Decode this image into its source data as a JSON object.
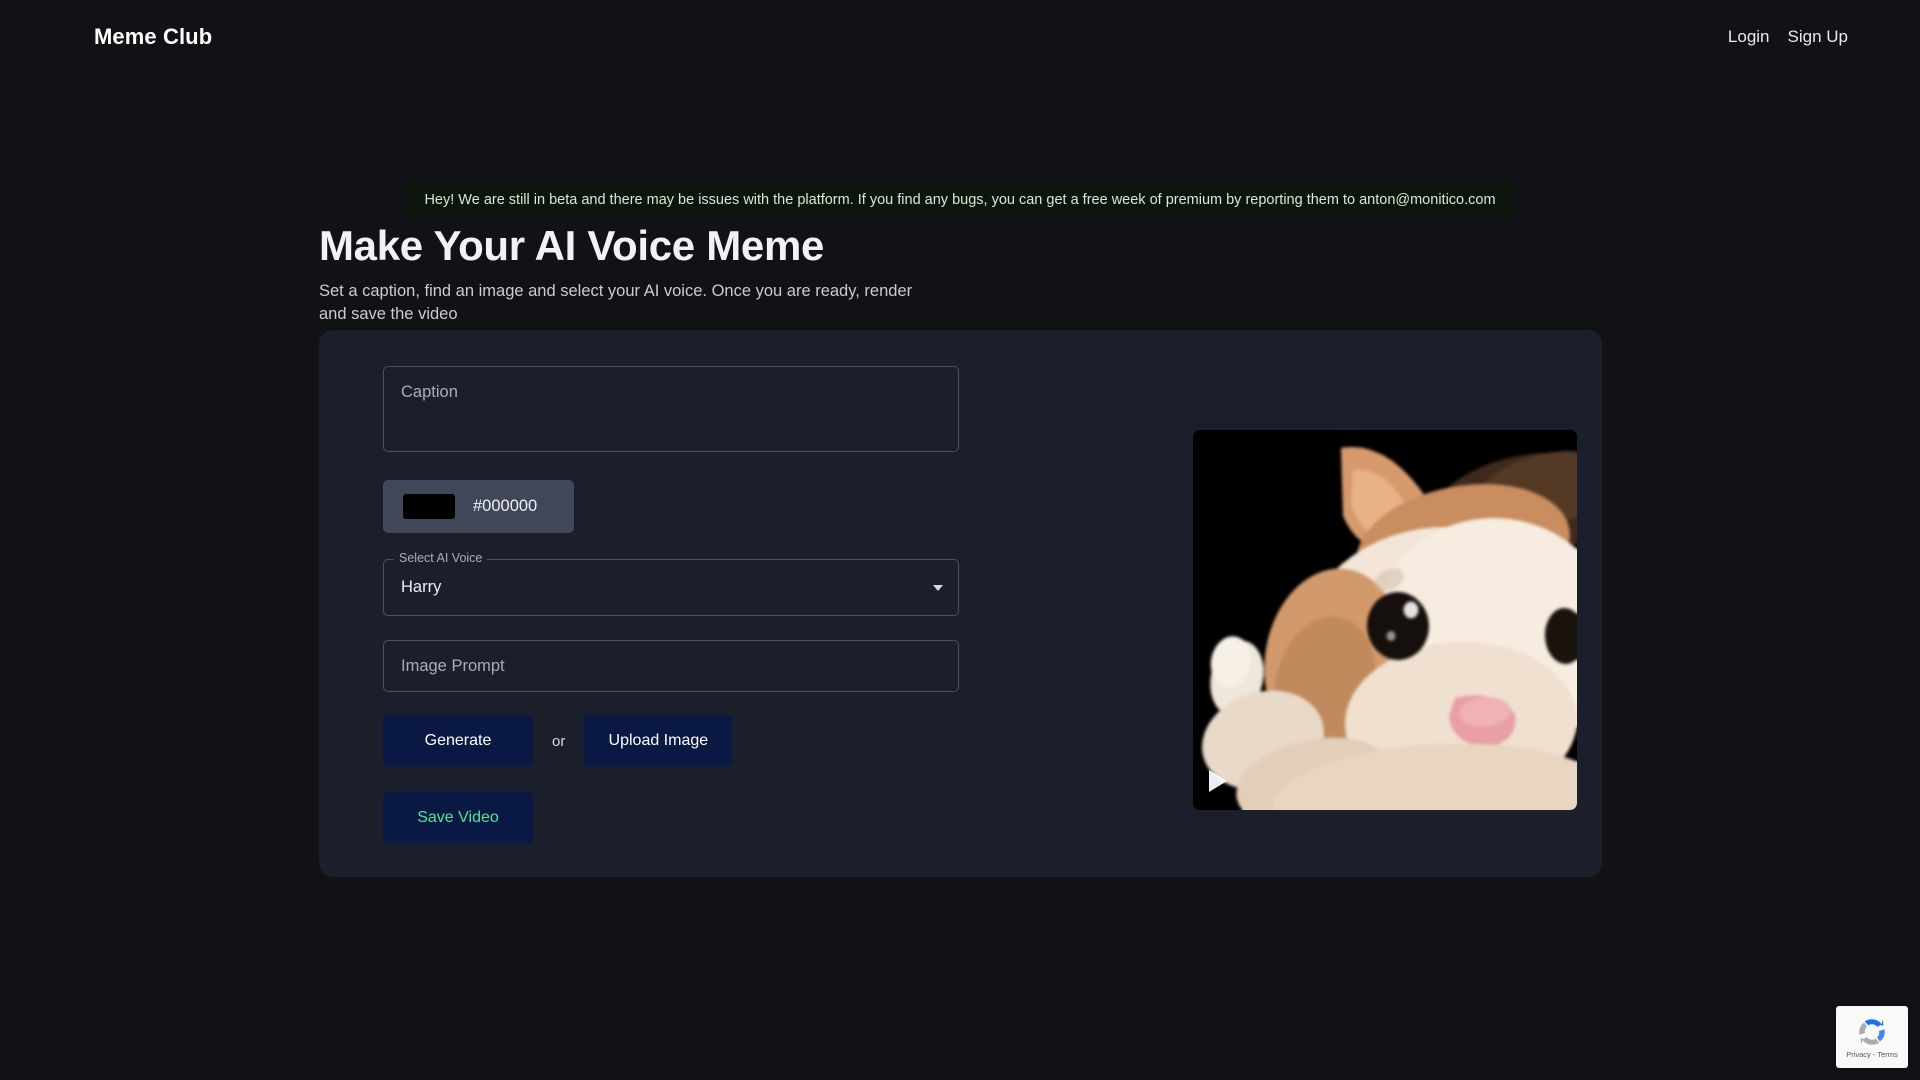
{
  "navbar": {
    "brand": "Meme Club",
    "links": [
      {
        "label": "Login"
      },
      {
        "label": "Sign Up"
      }
    ]
  },
  "banner": {
    "text": "Hey! We are still in beta and there may be issues with the platform. If you find any bugs, you can get a free week of premium by reporting them to anton@monitico.com",
    "background_color": "#0c150c",
    "text_color": "#d5ead4"
  },
  "hero": {
    "title": "Make Your AI Voice Meme",
    "subtitle": "Set a caption, find an image and select your AI voice. Once you are ready, render and save the video"
  },
  "form": {
    "caption": {
      "label": "Caption",
      "placeholder": "Caption",
      "value": ""
    },
    "color_picker": {
      "value": "#000000",
      "swatch_color": "#000000",
      "background_color": "#3f4758"
    },
    "voice_select": {
      "legend": "Select AI Voice",
      "value": "Harry",
      "caret_icon": "chevron-down-icon"
    },
    "image_prompt": {
      "placeholder": "Image Prompt",
      "value": ""
    },
    "generate_button": "Generate",
    "or_text": "or",
    "upload_button": "Upload Image",
    "save_button": "Save Video",
    "button_color": "#0a1944",
    "save_button_text_color": "#4ee59a"
  },
  "preview": {
    "play_icon": "play-icon",
    "background_color": "#000000"
  },
  "recaptcha": {
    "text": "Privacy - Terms",
    "logo_icon": "recaptcha-icon"
  }
}
